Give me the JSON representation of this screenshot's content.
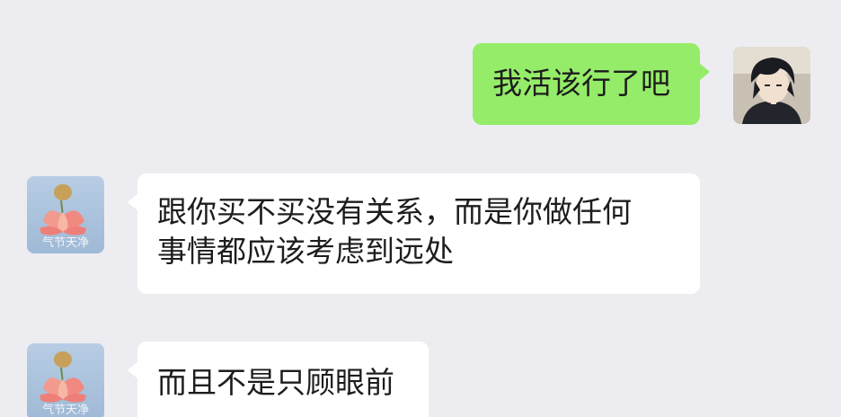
{
  "messages": [
    {
      "side": "out",
      "text": "我活该行了吧",
      "avatar": "user-avatar"
    },
    {
      "side": "in",
      "line1": "跟你买不买没有关系，而是你做任何",
      "line2": "事情都应该考虑到远处",
      "avatar": "lotus-avatar"
    },
    {
      "side": "in",
      "text": "而且不是只顾眼前",
      "avatar": "lotus-avatar"
    }
  ],
  "lotus_avatar_caption": "气节天净",
  "colors": {
    "background": "#ededf1",
    "outgoing_bubble": "#95ec69",
    "incoming_bubble": "#ffffff",
    "text": "#1d1d1d"
  }
}
